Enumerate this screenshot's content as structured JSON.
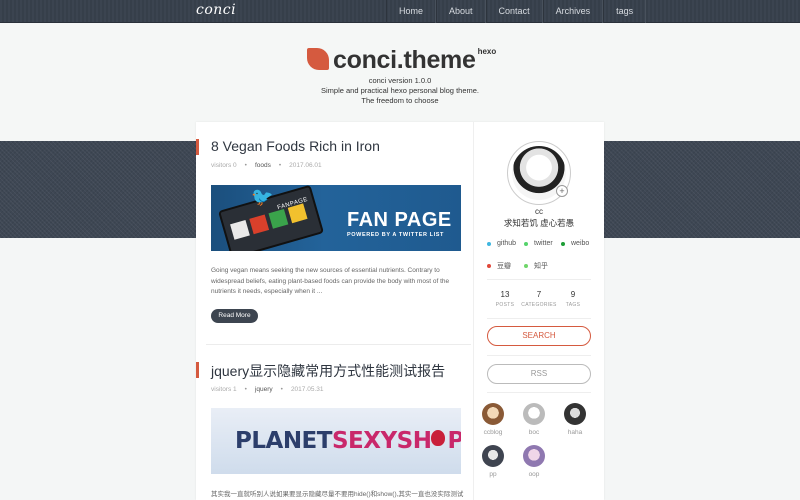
{
  "site": {
    "logo": "conci"
  },
  "nav": [
    "Home",
    "About",
    "Contact",
    "Archives",
    "tags"
  ],
  "hero": {
    "brand": "conci.theme",
    "brand_sup": "hexo",
    "lines": [
      "conci version 1.0.0",
      "Simple and practical hexo personal blog theme.",
      "The freedom to choose"
    ]
  },
  "posts": [
    {
      "title": "8 Vegan Foods Rich in Iron",
      "visitors": "visitors 0",
      "category": "foods",
      "date": "2017.06.01",
      "image": {
        "title": "FAN PAGE",
        "subtitle": "POWERED BY A TWITTER LIST",
        "label": "FANPAGE"
      },
      "excerpt": "Going vegan means seeking the new sources of essential nutrients. Contrary to widespread beliefs, eating plant-based foods can provide the body with most of the nutrients it needs, especially when it ...",
      "read_more": "Read More"
    },
    {
      "title": "jquery显示隐藏常用方式性能测试报告",
      "visitors": "visitors 1",
      "category": "jquery",
      "date": "2017.05.31",
      "image": {
        "text_a": "PLANET",
        "text_b": "SEXYSH",
        "text_c": "P"
      },
      "excerpt": "其实我一直就听别人说如果要显示隐藏尽量不要用hide()和show(),其实一直也没实际测试过，因为"
    }
  ],
  "sidebar": {
    "author": "cc",
    "motto": "求知若饥 虚心若愚",
    "social": [
      {
        "label": "github",
        "color": "#3fb6e0"
      },
      {
        "label": "twitter",
        "color": "#55d36b"
      },
      {
        "label": "weibo",
        "color": "#1d9e36"
      },
      {
        "label": "豆瓣",
        "color": "#e0483a"
      },
      {
        "label": "知乎",
        "color": "#6fd66a"
      }
    ],
    "stats": [
      {
        "num": "13",
        "label": "POSTS"
      },
      {
        "num": "7",
        "label": "CATEGORIES"
      },
      {
        "num": "9",
        "label": "TAGS"
      }
    ],
    "search": "SEARCH",
    "rss": "RSS",
    "friends": [
      {
        "name": "ccblog",
        "color": "#c89b6a"
      },
      {
        "name": "boc",
        "color": "#d9d9d9"
      },
      {
        "name": "haha",
        "color": "#4a4a4a"
      },
      {
        "name": "pp",
        "color": "#555a66"
      },
      {
        "name": "oop",
        "color": "#b39ac9"
      }
    ]
  },
  "colors": {
    "accent": "#d55a3f",
    "nav_bg": "#3b4450",
    "band": "#3e4754"
  }
}
